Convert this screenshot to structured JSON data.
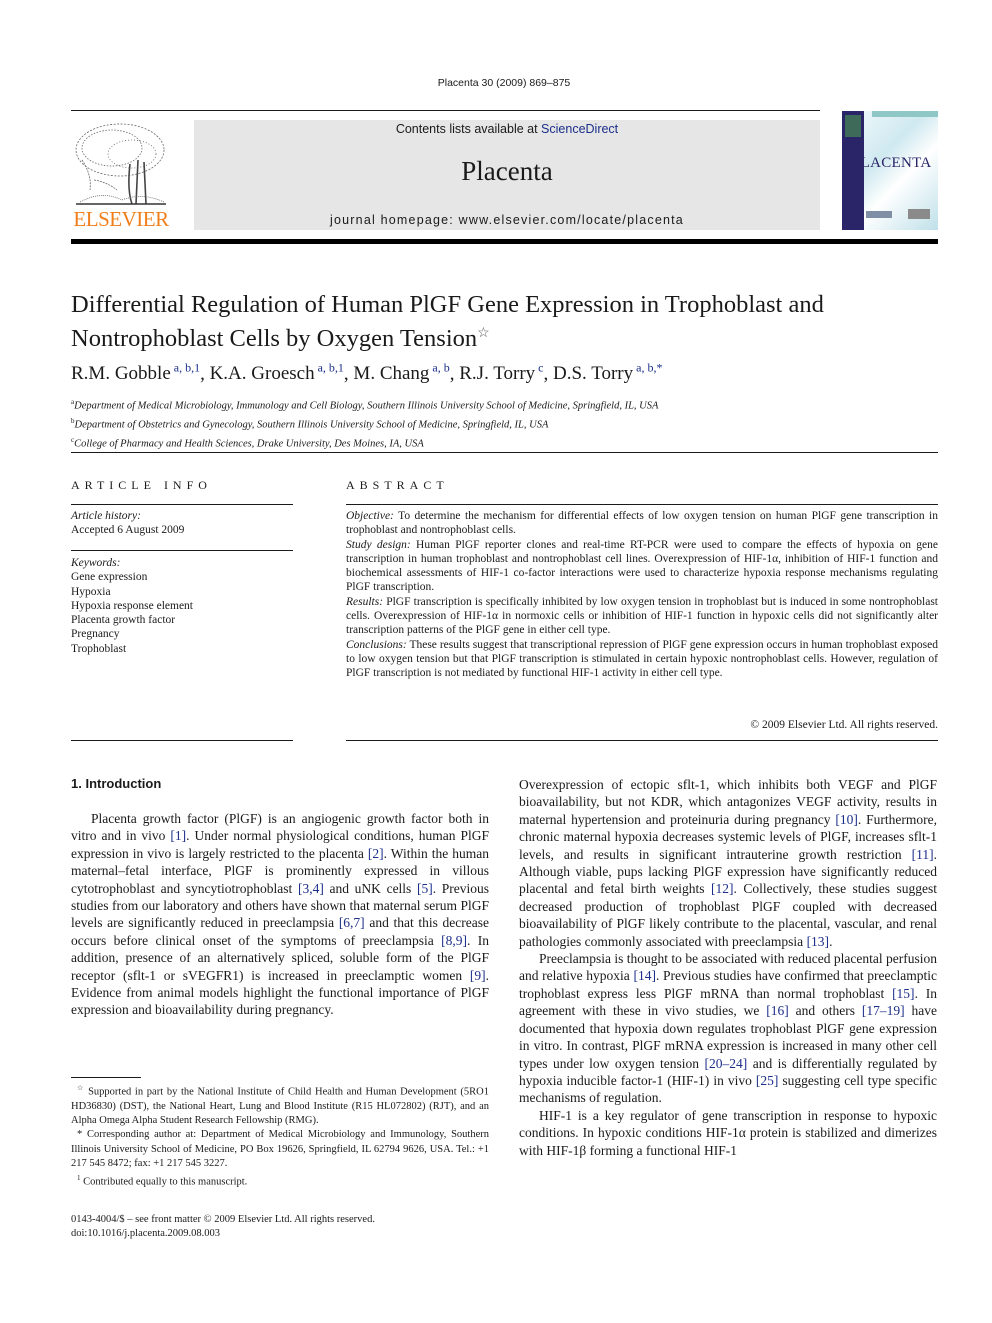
{
  "header": {
    "journal_ref": "Placenta 30 (2009) 869–875",
    "contents_prefix": "Contents lists available at ",
    "contents_link": "ScienceDirect",
    "journal_name": "Placenta",
    "homepage": "journal homepage: www.elsevier.com/locate/placenta",
    "publisher": "ELSEVIER",
    "cover_title": "PLACENTA",
    "colors": {
      "publisher_orange": "#f07f1b",
      "link_blue": "#1b2e8a",
      "masthead_gray": "#e6e6e6",
      "cover_spine": "#2a2468"
    }
  },
  "article": {
    "title": "Differential Regulation of Human PlGF Gene Expression in Trophoblast and Nontrophoblast Cells by Oxygen Tension",
    "title_mark": "☆",
    "authors": [
      {
        "name": "R.M. Gobble",
        "sup": "a, b,1"
      },
      {
        "name": "K.A. Groesch",
        "sup": "a, b,1"
      },
      {
        "name": "M. Chang",
        "sup": "a, b"
      },
      {
        "name": "R.J. Torry",
        "sup": "c"
      },
      {
        "name": "D.S. Torry",
        "sup": "a, b,*"
      }
    ],
    "affiliations": [
      {
        "mark": "a",
        "text": "Department of Medical Microbiology, Immunology and Cell Biology, Southern Illinois University School of Medicine, Springfield, IL, USA"
      },
      {
        "mark": "b",
        "text": "Department of Obstetrics and Gynecology, Southern Illinois University School of Medicine, Springfield, IL, USA"
      },
      {
        "mark": "c",
        "text": "College of Pharmacy and Health Sciences, Drake University, Des Moines, IA, USA"
      }
    ]
  },
  "article_info": {
    "label": "ARTICLE INFO",
    "history_label": "Article history:",
    "history": "Accepted 6 August 2009",
    "keywords_label": "Keywords:",
    "keywords": [
      "Gene expression",
      "Hypoxia",
      "Hypoxia response element",
      "Placenta growth factor",
      "Pregnancy",
      "Trophoblast"
    ]
  },
  "abstract": {
    "label": "ABSTRACT",
    "sections": [
      {
        "head": "Objective:",
        "text": " To determine the mechanism for differential effects of low oxygen tension on human PlGF gene transcription in trophoblast and nontrophoblast cells."
      },
      {
        "head": "Study design:",
        "text": " Human PlGF reporter clones and real-time RT-PCR were used to compare the effects of hypoxia on gene transcription in human trophoblast and nontrophoblast cell lines. Overexpression of HIF-1α, inhibition of HIF-1 function and biochemical assessments of HIF-1 co-factor interactions were used to characterize hypoxia response mechanisms regulating PlGF transcription."
      },
      {
        "head": "Results:",
        "text": " PlGF transcription is specifically inhibited by low oxygen tension in trophoblast but is induced in some nontrophoblast cells. Overexpression of HIF-1α in normoxic cells or inhibition of HIF-1 function in hypoxic cells did not significantly alter transcription patterns of the PlGF gene in either cell type."
      },
      {
        "head": "Conclusions:",
        "text": " These results suggest that transcriptional repression of PlGF gene expression occurs in human trophoblast exposed to low oxygen tension but that PlGF transcription is stimulated in certain hypoxic nontrophoblast cells. However, regulation of PlGF transcription is not mediated by functional HIF-1 activity in either cell type."
      }
    ],
    "copyright": "© 2009 Elsevier Ltd. All rights reserved."
  },
  "body": {
    "intro_heading": "1.  Introduction",
    "left_column": [
      "Placenta growth factor (PlGF) is an angiogenic growth factor both in vitro and in vivo [1]. Under normal physiological conditions, human PlGF expression in vivo is largely restricted to the placenta [2]. Within the human maternal–fetal interface, PlGF is prominently expressed in villous cytotrophoblast and syncytiotrophoblast [3,4] and uNK cells [5]. Previous studies from our laboratory and others have shown that maternal serum PlGF levels are significantly reduced in preeclampsia [6,7] and that this decrease occurs before clinical onset of the symptoms of preeclampsia [8,9]. In addition, presence of an alternatively spliced, soluble form of the PlGF receptor (sflt-1 or sVEGFR1) is increased in preeclamptic women [9]. Evidence from animal models highlight the functional importance of PlGF expression and bioavailability during pregnancy."
    ],
    "right_column": [
      "Overexpression of ectopic sflt-1, which inhibits both VEGF and PlGF bioavailability, but not KDR, which antagonizes VEGF activity, results in maternal hypertension and proteinuria during pregnancy [10]. Furthermore, chronic maternal hypoxia decreases systemic levels of PlGF, increases sflt-1 levels, and results in significant intrauterine growth restriction [11]. Although viable, pups lacking PlGF expression have significantly reduced placental and fetal birth weights [12]. Collectively, these studies suggest decreased production of trophoblast PlGF coupled with decreased bioavailability of PlGF likely contribute to the placental, vascular, and renal pathologies commonly associated with preeclampsia [13].",
      "Preeclampsia is thought to be associated with reduced placental perfusion and relative hypoxia [14]. Previous studies have confirmed that preeclamptic trophoblast express less PlGF mRNA than normal trophoblast [15]. In agreement with these in vivo studies, we [16] and others [17–19] have documented that hypoxia down regulates trophoblast PlGF gene expression in vitro. In contrast, PlGF mRNA expression is increased in many other cell types under low oxygen tension [20–24] and is differentially regulated by hypoxia inducible factor-1 (HIF-1) in vivo [25] suggesting cell type specific mechanisms of regulation.",
      "HIF-1 is a key regulator of gene transcription in response to hypoxic conditions. In hypoxic conditions HIF-1α protein is stabilized and dimerizes with HIF-1β forming a functional HIF-1"
    ]
  },
  "footnotes": [
    {
      "mark": "☆",
      "text": "Supported in part by the National Institute of Child Health and Human Development (5RO1 HD36830) (DST), the National Heart, Lung and Blood Institute (R15 HL072802) (RJT), and an Alpha Omega Alpha Student Research Fellowship (RMG)."
    },
    {
      "mark": "*",
      "text": "Corresponding author at: Department of Medical Microbiology and Immunology, Southern Illinois University School of Medicine, PO Box 19626, Springfield, IL 62794 9626, USA. Tel.: +1 217 545 8472; fax: +1 217 545 3227."
    },
    {
      "mark": "1",
      "text": "Contributed equally to this manuscript."
    }
  ],
  "front_matter": {
    "issn": "0143-4004/$ – see front matter © 2009 Elsevier Ltd. All rights reserved.",
    "doi": "doi:10.1016/j.placenta.2009.08.003"
  }
}
